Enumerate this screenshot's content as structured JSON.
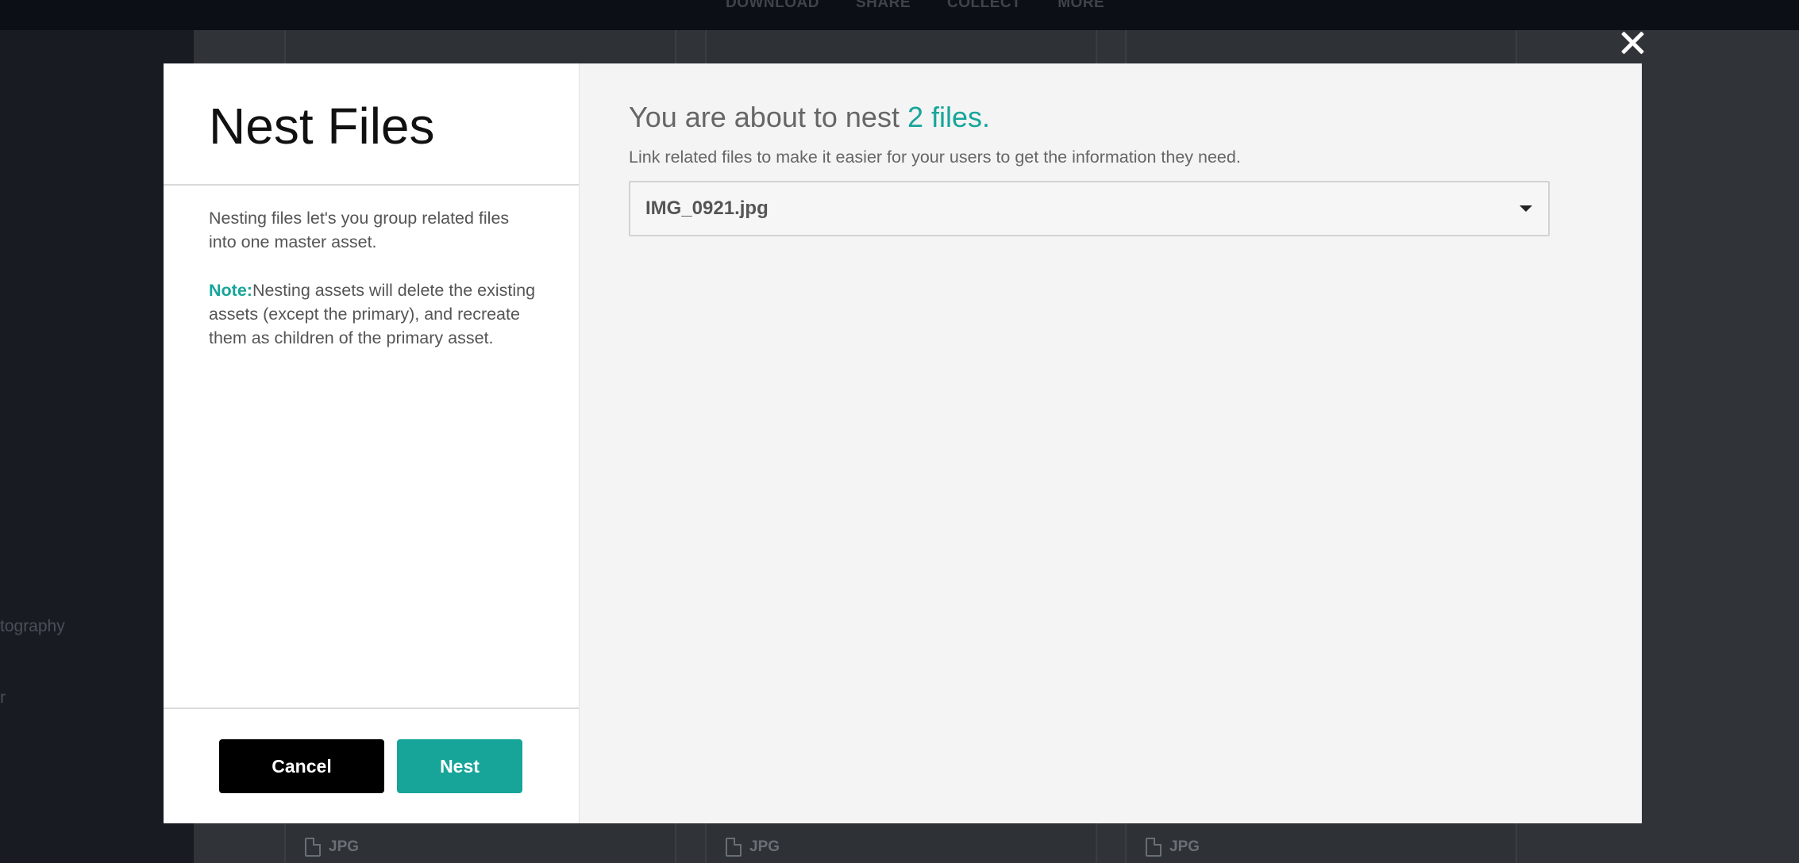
{
  "background": {
    "actions": [
      "DOWNLOAD",
      "SHARE",
      "COLLECT",
      "MORE"
    ],
    "sidebar_items": [
      "tography",
      "r"
    ],
    "card_types": [
      "JPG",
      "JPG",
      "JPG"
    ]
  },
  "modal": {
    "title": "Nest Files",
    "description": "Nesting files let's you group related files into one master asset.",
    "note_label": "Note:",
    "note_text": "Nesting assets will delete the existing assets (except the primary), and recreate them as children of the primary asset.",
    "headline_prefix": "You are about to nest",
    "headline_count": "2 files.",
    "subtext": "Link related files to make it easier for your users to get the information they need.",
    "select_value": "IMG_0921.jpg",
    "cancel_label": "Cancel",
    "nest_label": "Nest"
  },
  "colors": {
    "accent": "#17a59a",
    "cancel_button": "#000000",
    "overlay": "#181c21"
  },
  "icons": {
    "close": "close-icon",
    "dropdown": "chevron-down-icon",
    "file": "file-icon"
  }
}
